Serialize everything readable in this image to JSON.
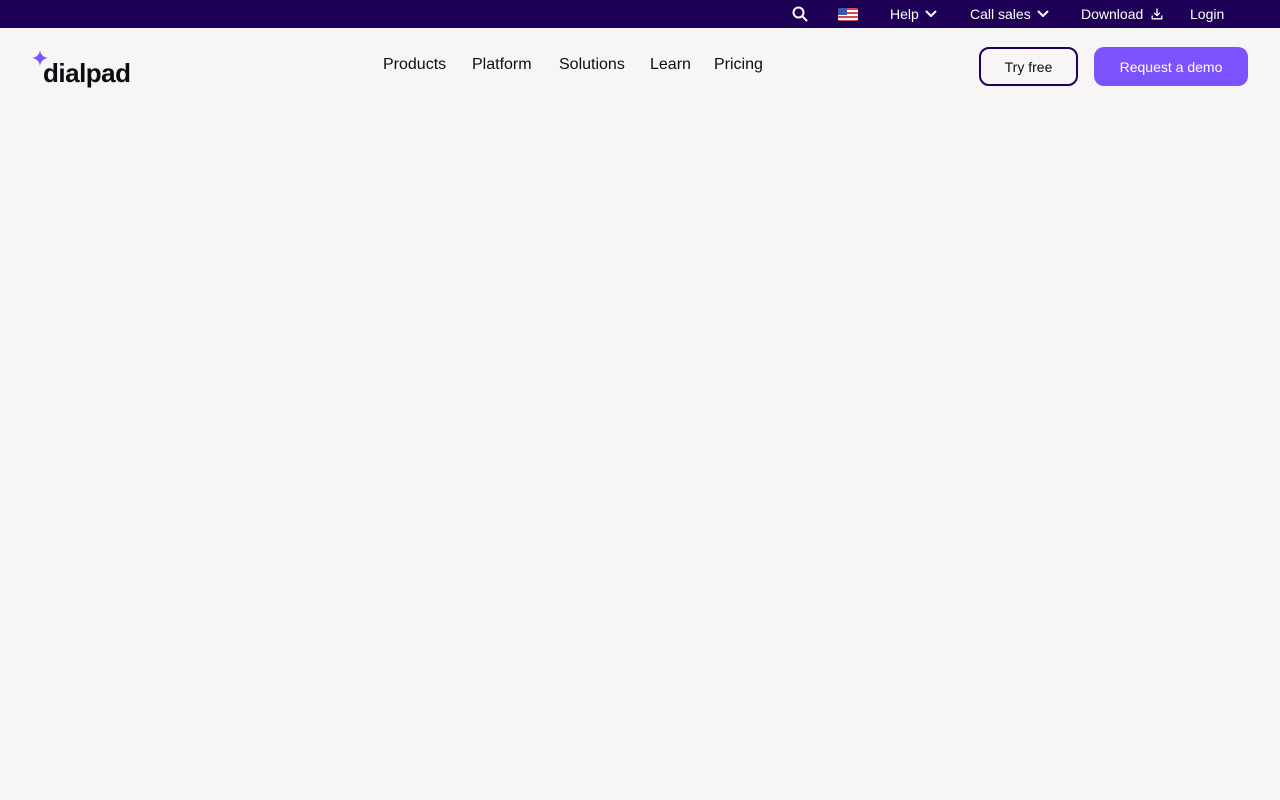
{
  "topbar": {
    "search_icon": "search-icon",
    "flag_icon": "us-flag-icon",
    "help_label": "Help",
    "call_sales_label": "Call sales",
    "download_label": "Download",
    "login_label": "Login",
    "background_color": "#1e0057"
  },
  "nav": {
    "logo_text": "dialpad",
    "items": [
      {
        "label": "Products"
      },
      {
        "label": "Platform"
      },
      {
        "label": "Solutions"
      },
      {
        "label": "Learn"
      },
      {
        "label": "Pricing"
      }
    ],
    "try_free_label": "Try free",
    "request_demo_label": "Request a demo",
    "accent_color": "#7c52ff"
  }
}
